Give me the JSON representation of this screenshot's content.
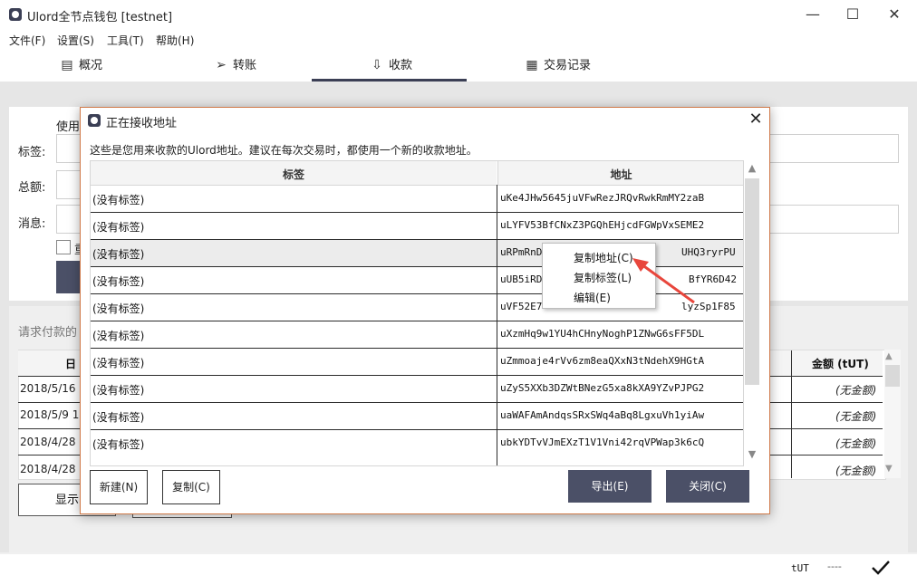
{
  "window": {
    "title": "Ulord全节点钱包 [testnet]",
    "controls": {
      "minimize": "—",
      "maximize": "☐",
      "close": "✕"
    }
  },
  "menu": [
    "文件(F)",
    "设置(S)",
    "工具(T)",
    "帮助(H)"
  ],
  "tabs": [
    {
      "label": "概况",
      "icon": "overview-icon"
    },
    {
      "label": "转账",
      "icon": "send-icon"
    },
    {
      "label": "收款",
      "icon": "receive-icon",
      "active": true
    },
    {
      "label": "交易记录",
      "icon": "history-icon"
    }
  ],
  "receive_form": {
    "use_label": "使用",
    "label_field": "标签:",
    "amount_field": "总额:",
    "message_field": "消息:",
    "partial_checkbox_text": "重"
  },
  "requests": {
    "title": "请求付款的",
    "date_header": "日",
    "amount_header": "金额 (tUT)",
    "rows": [
      {
        "date": "2018/5/16",
        "amount": "(无金额)"
      },
      {
        "date": "2018/5/9 1",
        "amount": "(无金额)"
      },
      {
        "date": "2018/4/28",
        "amount": "(无金额)"
      },
      {
        "date": "2018/4/28",
        "amount": "(无金额)"
      }
    ],
    "show_button": "显示"
  },
  "status": {
    "unit": "tUT",
    "dots": "----",
    "sync_icon": "checkmark-icon"
  },
  "dialog": {
    "title": "正在接收地址",
    "description": "这些是您用来收款的Ulord地址。建议在每次交易时，都使用一个新的收款地址。",
    "columns": {
      "label": "标签",
      "address": "地址"
    },
    "rows": [
      {
        "label": "(没有标签)",
        "address": "uKe4JHw5645juVFwRezJRQvRwkRmMY2zaB"
      },
      {
        "label": "(没有标签)",
        "address": "uLYFV53BfCNxZ3PGQhEHjcdFGWpVxSEME2"
      },
      {
        "label": "(没有标签)",
        "address": "uRPmRnD",
        "address_tail": "UHQ3ryrPU",
        "selected": true
      },
      {
        "label": "(没有标签)",
        "address": "uUB5iRD",
        "address_tail": "BfYR6D42"
      },
      {
        "label": "(没有标签)",
        "address": "uVF52E7",
        "address_tail": "lyzSp1F85"
      },
      {
        "label": "(没有标签)",
        "address": "uXzmHq9w1YU4hCHnyNoghP1ZNwG6sFF5DL"
      },
      {
        "label": "(没有标签)",
        "address": "uZmmoaje4rVv6zm8eaQXxN3tNdehX9HGtA"
      },
      {
        "label": "(没有标签)",
        "address": "uZyS5XXb3DZWtBNezG5xa8kXA9YZvPJPG2"
      },
      {
        "label": "(没有标签)",
        "address": "uaWAFAmAndqsSRxSWq4aBq8LgxuVh1yiAw"
      },
      {
        "label": "(没有标签)",
        "address": "ubkYDTvVJmEXzT1V1Vni42rqVPWap3k6cQ"
      }
    ],
    "buttons": {
      "new": "新建(N)",
      "copy": "复制(C)",
      "export": "导出(E)",
      "close": "关闭(C)"
    }
  },
  "context_menu": [
    "复制地址(C)",
    "复制标签(L)",
    "编辑(E)"
  ],
  "colors": {
    "accent": "#4b5067",
    "dialog_border": "#d07a4a",
    "annotation_arrow": "#e8463c"
  }
}
